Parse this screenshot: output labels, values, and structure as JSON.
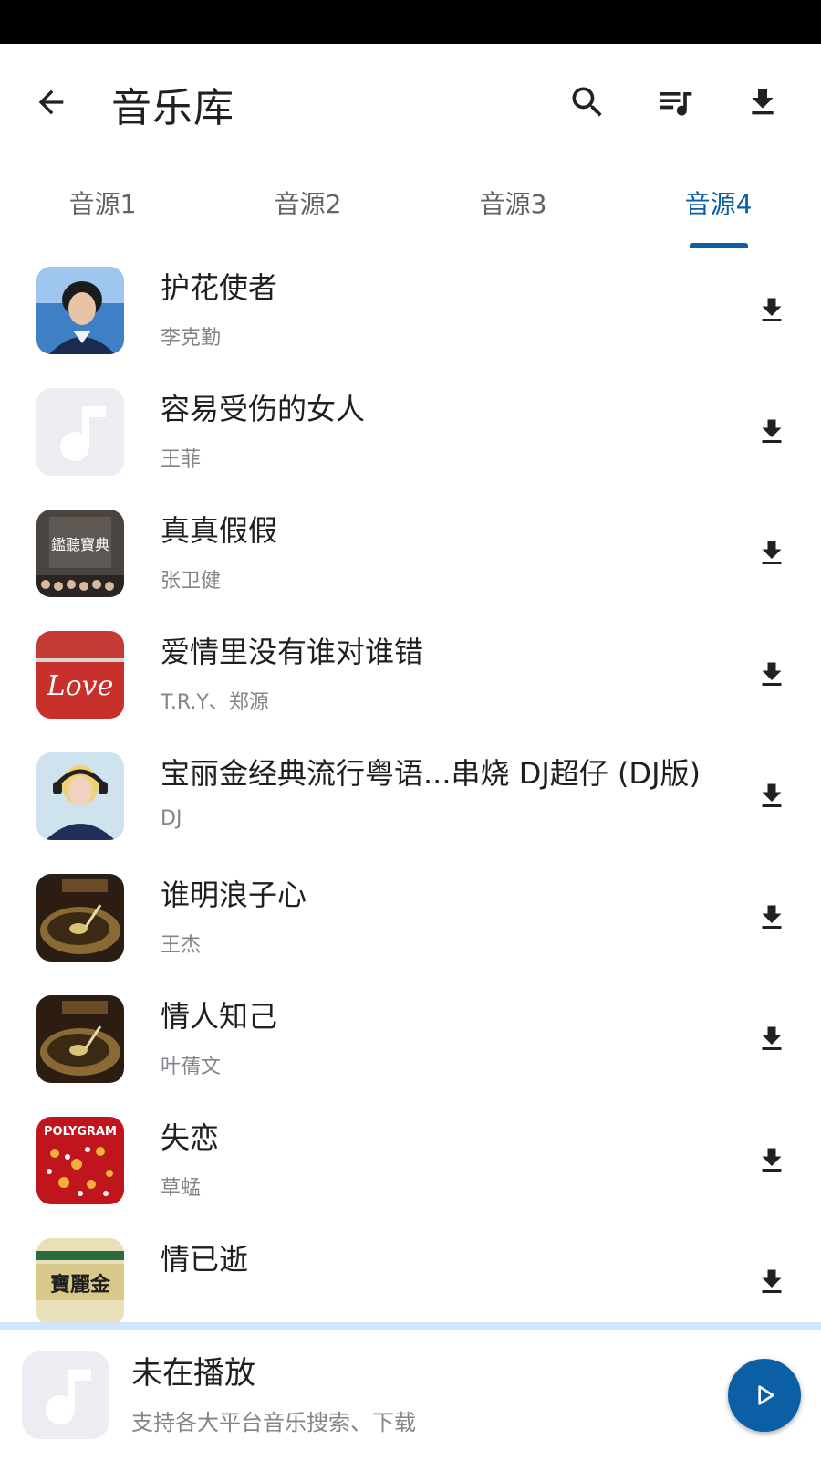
{
  "app_bar": {
    "title": "音乐库",
    "icons": [
      "back-arrow-icon",
      "search-icon",
      "playlist-queue-icon",
      "download-icon"
    ]
  },
  "tabs": [
    {
      "label": "音源1",
      "active": false
    },
    {
      "label": "音源2",
      "active": false
    },
    {
      "label": "音源3",
      "active": false
    },
    {
      "label": "音源4",
      "active": true
    }
  ],
  "colors": {
    "accent": "#0b5fa5",
    "player_divider": "#d2e3fc"
  },
  "songs": [
    {
      "title": "护花使者",
      "artist": "李克勤"
    },
    {
      "title": "容易受伤的女人",
      "artist": "王菲"
    },
    {
      "title": "真真假假",
      "artist": "张卫健"
    },
    {
      "title": "爱情里没有谁对谁错",
      "artist": "T.R.Y、郑源"
    },
    {
      "title": "宝丽金经典流行粤语...串烧 DJ超仔 (DJ版)",
      "artist": "DJ"
    },
    {
      "title": "谁明浪子心",
      "artist": "王杰"
    },
    {
      "title": "情人知己",
      "artist": "叶蒨文"
    },
    {
      "title": "失恋",
      "artist": "草蜢"
    },
    {
      "title": "情已逝",
      "artist": ""
    }
  ],
  "cover_texts": {
    "song3": "鑑聽寶典",
    "song4": "Love",
    "song8": "POLYGRAM",
    "song9": "寶麗金"
  },
  "player": {
    "title": "未在播放",
    "subtitle": "支持各大平台音乐搜索、下载"
  }
}
